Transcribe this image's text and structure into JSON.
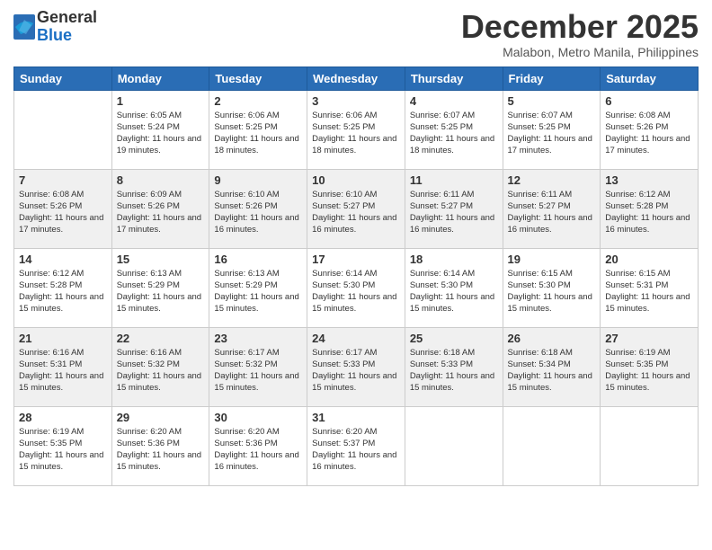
{
  "logo": {
    "general": "General",
    "blue": "Blue"
  },
  "title": "December 2025",
  "location": "Malabon, Metro Manila, Philippines",
  "headers": [
    "Sunday",
    "Monday",
    "Tuesday",
    "Wednesday",
    "Thursday",
    "Friday",
    "Saturday"
  ],
  "rows": [
    [
      {
        "day": "",
        "sunrise": "",
        "sunset": "",
        "daylight": ""
      },
      {
        "day": "1",
        "sunrise": "Sunrise: 6:05 AM",
        "sunset": "Sunset: 5:24 PM",
        "daylight": "Daylight: 11 hours and 19 minutes."
      },
      {
        "day": "2",
        "sunrise": "Sunrise: 6:06 AM",
        "sunset": "Sunset: 5:25 PM",
        "daylight": "Daylight: 11 hours and 18 minutes."
      },
      {
        "day": "3",
        "sunrise": "Sunrise: 6:06 AM",
        "sunset": "Sunset: 5:25 PM",
        "daylight": "Daylight: 11 hours and 18 minutes."
      },
      {
        "day": "4",
        "sunrise": "Sunrise: 6:07 AM",
        "sunset": "Sunset: 5:25 PM",
        "daylight": "Daylight: 11 hours and 18 minutes."
      },
      {
        "day": "5",
        "sunrise": "Sunrise: 6:07 AM",
        "sunset": "Sunset: 5:25 PM",
        "daylight": "Daylight: 11 hours and 17 minutes."
      },
      {
        "day": "6",
        "sunrise": "Sunrise: 6:08 AM",
        "sunset": "Sunset: 5:26 PM",
        "daylight": "Daylight: 11 hours and 17 minutes."
      }
    ],
    [
      {
        "day": "7",
        "sunrise": "Sunrise: 6:08 AM",
        "sunset": "Sunset: 5:26 PM",
        "daylight": "Daylight: 11 hours and 17 minutes."
      },
      {
        "day": "8",
        "sunrise": "Sunrise: 6:09 AM",
        "sunset": "Sunset: 5:26 PM",
        "daylight": "Daylight: 11 hours and 17 minutes."
      },
      {
        "day": "9",
        "sunrise": "Sunrise: 6:10 AM",
        "sunset": "Sunset: 5:26 PM",
        "daylight": "Daylight: 11 hours and 16 minutes."
      },
      {
        "day": "10",
        "sunrise": "Sunrise: 6:10 AM",
        "sunset": "Sunset: 5:27 PM",
        "daylight": "Daylight: 11 hours and 16 minutes."
      },
      {
        "day": "11",
        "sunrise": "Sunrise: 6:11 AM",
        "sunset": "Sunset: 5:27 PM",
        "daylight": "Daylight: 11 hours and 16 minutes."
      },
      {
        "day": "12",
        "sunrise": "Sunrise: 6:11 AM",
        "sunset": "Sunset: 5:27 PM",
        "daylight": "Daylight: 11 hours and 16 minutes."
      },
      {
        "day": "13",
        "sunrise": "Sunrise: 6:12 AM",
        "sunset": "Sunset: 5:28 PM",
        "daylight": "Daylight: 11 hours and 16 minutes."
      }
    ],
    [
      {
        "day": "14",
        "sunrise": "Sunrise: 6:12 AM",
        "sunset": "Sunset: 5:28 PM",
        "daylight": "Daylight: 11 hours and 15 minutes."
      },
      {
        "day": "15",
        "sunrise": "Sunrise: 6:13 AM",
        "sunset": "Sunset: 5:29 PM",
        "daylight": "Daylight: 11 hours and 15 minutes."
      },
      {
        "day": "16",
        "sunrise": "Sunrise: 6:13 AM",
        "sunset": "Sunset: 5:29 PM",
        "daylight": "Daylight: 11 hours and 15 minutes."
      },
      {
        "day": "17",
        "sunrise": "Sunrise: 6:14 AM",
        "sunset": "Sunset: 5:30 PM",
        "daylight": "Daylight: 11 hours and 15 minutes."
      },
      {
        "day": "18",
        "sunrise": "Sunrise: 6:14 AM",
        "sunset": "Sunset: 5:30 PM",
        "daylight": "Daylight: 11 hours and 15 minutes."
      },
      {
        "day": "19",
        "sunrise": "Sunrise: 6:15 AM",
        "sunset": "Sunset: 5:30 PM",
        "daylight": "Daylight: 11 hours and 15 minutes."
      },
      {
        "day": "20",
        "sunrise": "Sunrise: 6:15 AM",
        "sunset": "Sunset: 5:31 PM",
        "daylight": "Daylight: 11 hours and 15 minutes."
      }
    ],
    [
      {
        "day": "21",
        "sunrise": "Sunrise: 6:16 AM",
        "sunset": "Sunset: 5:31 PM",
        "daylight": "Daylight: 11 hours and 15 minutes."
      },
      {
        "day": "22",
        "sunrise": "Sunrise: 6:16 AM",
        "sunset": "Sunset: 5:32 PM",
        "daylight": "Daylight: 11 hours and 15 minutes."
      },
      {
        "day": "23",
        "sunrise": "Sunrise: 6:17 AM",
        "sunset": "Sunset: 5:32 PM",
        "daylight": "Daylight: 11 hours and 15 minutes."
      },
      {
        "day": "24",
        "sunrise": "Sunrise: 6:17 AM",
        "sunset": "Sunset: 5:33 PM",
        "daylight": "Daylight: 11 hours and 15 minutes."
      },
      {
        "day": "25",
        "sunrise": "Sunrise: 6:18 AM",
        "sunset": "Sunset: 5:33 PM",
        "daylight": "Daylight: 11 hours and 15 minutes."
      },
      {
        "day": "26",
        "sunrise": "Sunrise: 6:18 AM",
        "sunset": "Sunset: 5:34 PM",
        "daylight": "Daylight: 11 hours and 15 minutes."
      },
      {
        "day": "27",
        "sunrise": "Sunrise: 6:19 AM",
        "sunset": "Sunset: 5:35 PM",
        "daylight": "Daylight: 11 hours and 15 minutes."
      }
    ],
    [
      {
        "day": "28",
        "sunrise": "Sunrise: 6:19 AM",
        "sunset": "Sunset: 5:35 PM",
        "daylight": "Daylight: 11 hours and 15 minutes."
      },
      {
        "day": "29",
        "sunrise": "Sunrise: 6:20 AM",
        "sunset": "Sunset: 5:36 PM",
        "daylight": "Daylight: 11 hours and 15 minutes."
      },
      {
        "day": "30",
        "sunrise": "Sunrise: 6:20 AM",
        "sunset": "Sunset: 5:36 PM",
        "daylight": "Daylight: 11 hours and 16 minutes."
      },
      {
        "day": "31",
        "sunrise": "Sunrise: 6:20 AM",
        "sunset": "Sunset: 5:37 PM",
        "daylight": "Daylight: 11 hours and 16 minutes."
      },
      {
        "day": "",
        "sunrise": "",
        "sunset": "",
        "daylight": ""
      },
      {
        "day": "",
        "sunrise": "",
        "sunset": "",
        "daylight": ""
      },
      {
        "day": "",
        "sunrise": "",
        "sunset": "",
        "daylight": ""
      }
    ]
  ]
}
